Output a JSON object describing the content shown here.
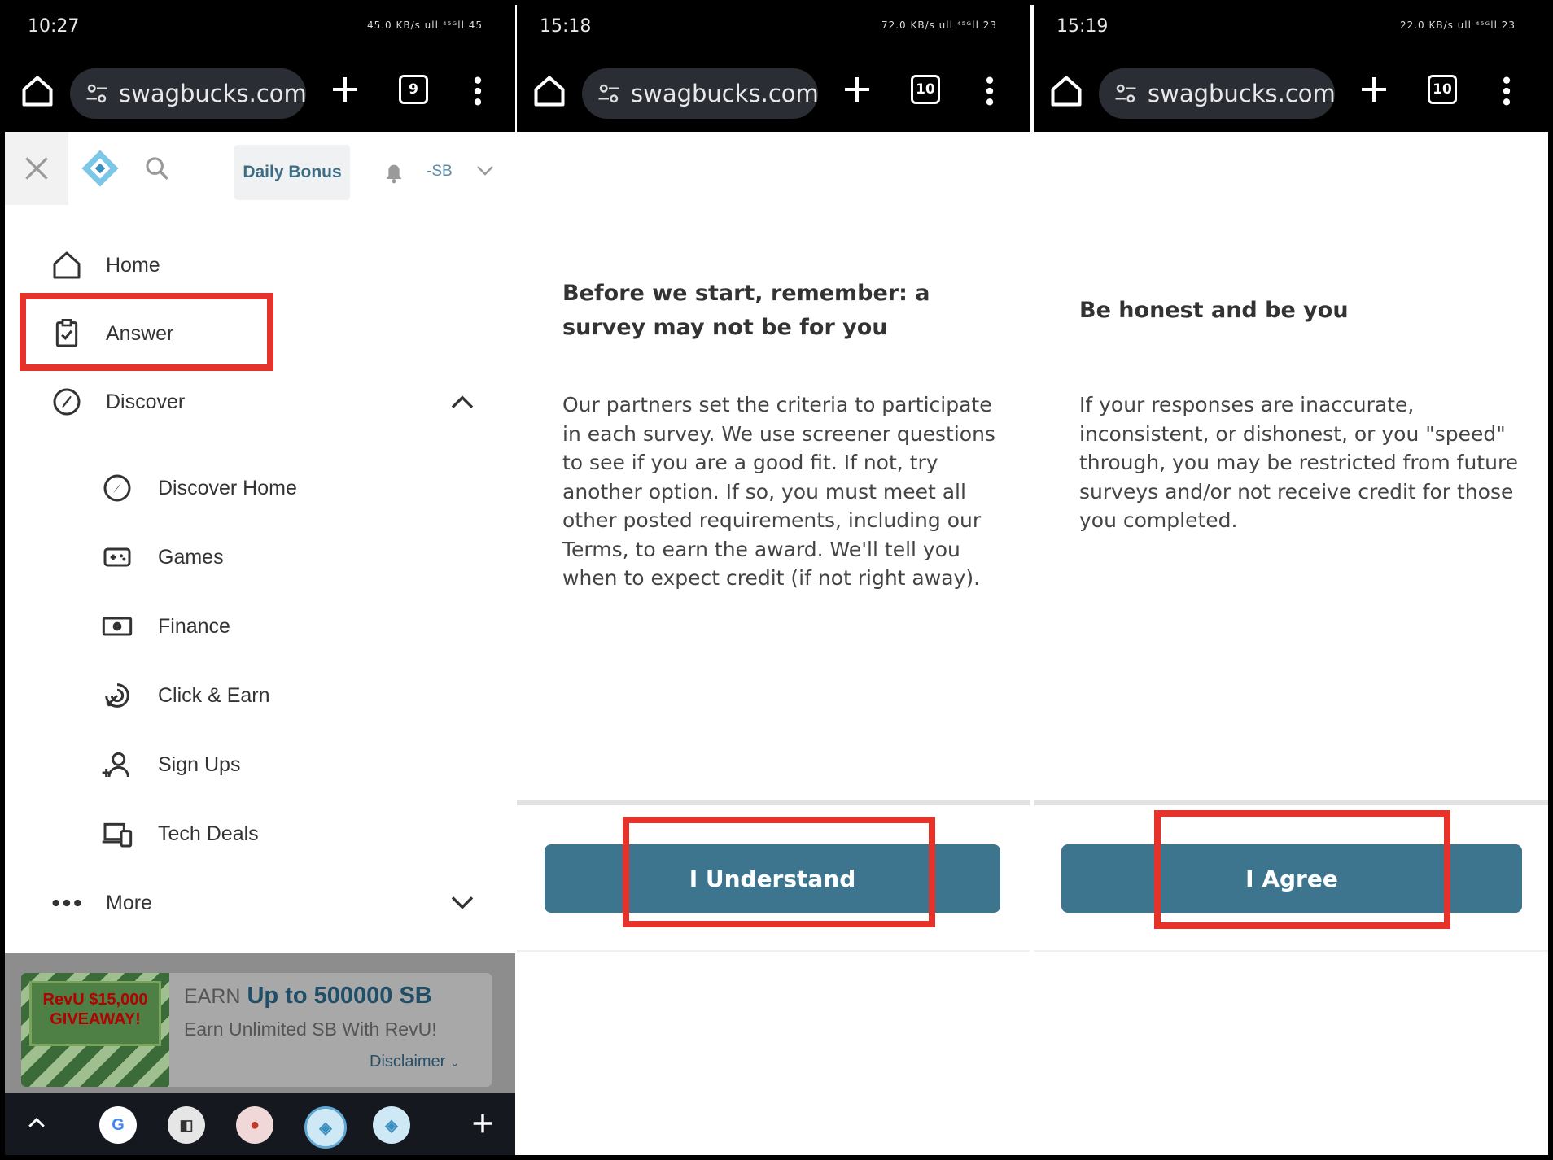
{
  "panels": [
    {
      "time": "10:27",
      "status_icons": "45.0 KB/s  ull  ⁴⁵ᴳll  45",
      "url": "swagbucks.com/c",
      "tab_count": "9"
    },
    {
      "time": "15:18",
      "status_icons": "72.0 KB/s  ull  ⁴⁵ᴳll  23",
      "url": "swagbucks.com/s",
      "tab_count": "10"
    },
    {
      "time": "15:19",
      "status_icons": "22.0 KB/s  ull  ⁴⁵ᴳll  23",
      "url": "swagbucks.com/s",
      "tab_count": "10"
    }
  ],
  "sidebar": {
    "daily_bonus": "Daily Bonus",
    "sb_balance": "-SB",
    "items": [
      {
        "label": "Home",
        "icon": "home-icon"
      },
      {
        "label": "Answer",
        "icon": "clipboard-check-icon"
      },
      {
        "label": "Discover",
        "icon": "compass-icon"
      }
    ],
    "sub_items": [
      {
        "label": "Discover Home",
        "icon": "compass-icon"
      },
      {
        "label": "Games",
        "icon": "gamepad-icon"
      },
      {
        "label": "Finance",
        "icon": "money-icon"
      },
      {
        "label": "Click & Earn",
        "icon": "click-icon"
      },
      {
        "label": "Sign Ups",
        "icon": "user-plus-icon"
      },
      {
        "label": "Tech Deals",
        "icon": "devices-icon"
      }
    ],
    "more": "More"
  },
  "ad": {
    "image_text": "RevU $15,000 GIVEAWAY!",
    "earn": "EARN",
    "headline": "Up to 500000 SB",
    "sub": "Earn Unlimited SB With RevU!",
    "disclaimer": "Disclaimer"
  },
  "survey_notice": {
    "title": "Before we start, remember: a survey may not be for you",
    "body": "Our partners set the criteria to participate in each survey. We use screener questions to see if you are a good fit. If not, try another option. If so, you must meet all other posted requirements, including our Terms, to earn the award. We'll tell you when to expect credit (if not right away).",
    "button": "I Understand"
  },
  "honesty_notice": {
    "title": "Be honest and be you",
    "body": "If your responses are inaccurate, inconsistent, or dishonest, or you \"speed\" through, you may be restricted from future surveys and/or not receive credit for those you completed.",
    "button": "I Agree"
  },
  "colors": {
    "accent": "#3c758d",
    "highlight": "#e5322b",
    "daily_bonus_text": "#3d6d84"
  }
}
